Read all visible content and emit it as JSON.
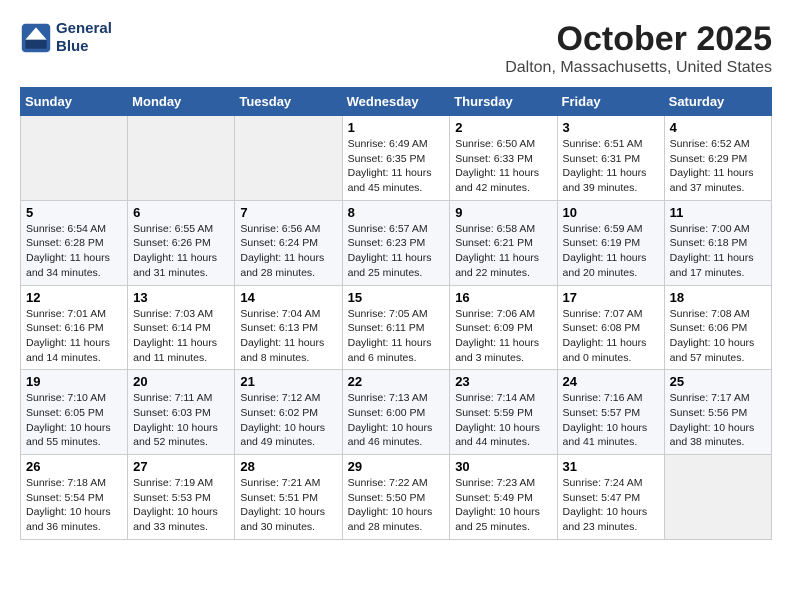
{
  "logo": {
    "line1": "General",
    "line2": "Blue"
  },
  "title": "October 2025",
  "location": "Dalton, Massachusetts, United States",
  "weekdays": [
    "Sunday",
    "Monday",
    "Tuesday",
    "Wednesday",
    "Thursday",
    "Friday",
    "Saturday"
  ],
  "weeks": [
    [
      {
        "day": "",
        "info": ""
      },
      {
        "day": "",
        "info": ""
      },
      {
        "day": "",
        "info": ""
      },
      {
        "day": "1",
        "info": "Sunrise: 6:49 AM\nSunset: 6:35 PM\nDaylight: 11 hours\nand 45 minutes."
      },
      {
        "day": "2",
        "info": "Sunrise: 6:50 AM\nSunset: 6:33 PM\nDaylight: 11 hours\nand 42 minutes."
      },
      {
        "day": "3",
        "info": "Sunrise: 6:51 AM\nSunset: 6:31 PM\nDaylight: 11 hours\nand 39 minutes."
      },
      {
        "day": "4",
        "info": "Sunrise: 6:52 AM\nSunset: 6:29 PM\nDaylight: 11 hours\nand 37 minutes."
      }
    ],
    [
      {
        "day": "5",
        "info": "Sunrise: 6:54 AM\nSunset: 6:28 PM\nDaylight: 11 hours\nand 34 minutes."
      },
      {
        "day": "6",
        "info": "Sunrise: 6:55 AM\nSunset: 6:26 PM\nDaylight: 11 hours\nand 31 minutes."
      },
      {
        "day": "7",
        "info": "Sunrise: 6:56 AM\nSunset: 6:24 PM\nDaylight: 11 hours\nand 28 minutes."
      },
      {
        "day": "8",
        "info": "Sunrise: 6:57 AM\nSunset: 6:23 PM\nDaylight: 11 hours\nand 25 minutes."
      },
      {
        "day": "9",
        "info": "Sunrise: 6:58 AM\nSunset: 6:21 PM\nDaylight: 11 hours\nand 22 minutes."
      },
      {
        "day": "10",
        "info": "Sunrise: 6:59 AM\nSunset: 6:19 PM\nDaylight: 11 hours\nand 20 minutes."
      },
      {
        "day": "11",
        "info": "Sunrise: 7:00 AM\nSunset: 6:18 PM\nDaylight: 11 hours\nand 17 minutes."
      }
    ],
    [
      {
        "day": "12",
        "info": "Sunrise: 7:01 AM\nSunset: 6:16 PM\nDaylight: 11 hours\nand 14 minutes."
      },
      {
        "day": "13",
        "info": "Sunrise: 7:03 AM\nSunset: 6:14 PM\nDaylight: 11 hours\nand 11 minutes."
      },
      {
        "day": "14",
        "info": "Sunrise: 7:04 AM\nSunset: 6:13 PM\nDaylight: 11 hours\nand 8 minutes."
      },
      {
        "day": "15",
        "info": "Sunrise: 7:05 AM\nSunset: 6:11 PM\nDaylight: 11 hours\nand 6 minutes."
      },
      {
        "day": "16",
        "info": "Sunrise: 7:06 AM\nSunset: 6:09 PM\nDaylight: 11 hours\nand 3 minutes."
      },
      {
        "day": "17",
        "info": "Sunrise: 7:07 AM\nSunset: 6:08 PM\nDaylight: 11 hours\nand 0 minutes."
      },
      {
        "day": "18",
        "info": "Sunrise: 7:08 AM\nSunset: 6:06 PM\nDaylight: 10 hours\nand 57 minutes."
      }
    ],
    [
      {
        "day": "19",
        "info": "Sunrise: 7:10 AM\nSunset: 6:05 PM\nDaylight: 10 hours\nand 55 minutes."
      },
      {
        "day": "20",
        "info": "Sunrise: 7:11 AM\nSunset: 6:03 PM\nDaylight: 10 hours\nand 52 minutes."
      },
      {
        "day": "21",
        "info": "Sunrise: 7:12 AM\nSunset: 6:02 PM\nDaylight: 10 hours\nand 49 minutes."
      },
      {
        "day": "22",
        "info": "Sunrise: 7:13 AM\nSunset: 6:00 PM\nDaylight: 10 hours\nand 46 minutes."
      },
      {
        "day": "23",
        "info": "Sunrise: 7:14 AM\nSunset: 5:59 PM\nDaylight: 10 hours\nand 44 minutes."
      },
      {
        "day": "24",
        "info": "Sunrise: 7:16 AM\nSunset: 5:57 PM\nDaylight: 10 hours\nand 41 minutes."
      },
      {
        "day": "25",
        "info": "Sunrise: 7:17 AM\nSunset: 5:56 PM\nDaylight: 10 hours\nand 38 minutes."
      }
    ],
    [
      {
        "day": "26",
        "info": "Sunrise: 7:18 AM\nSunset: 5:54 PM\nDaylight: 10 hours\nand 36 minutes."
      },
      {
        "day": "27",
        "info": "Sunrise: 7:19 AM\nSunset: 5:53 PM\nDaylight: 10 hours\nand 33 minutes."
      },
      {
        "day": "28",
        "info": "Sunrise: 7:21 AM\nSunset: 5:51 PM\nDaylight: 10 hours\nand 30 minutes."
      },
      {
        "day": "29",
        "info": "Sunrise: 7:22 AM\nSunset: 5:50 PM\nDaylight: 10 hours\nand 28 minutes."
      },
      {
        "day": "30",
        "info": "Sunrise: 7:23 AM\nSunset: 5:49 PM\nDaylight: 10 hours\nand 25 minutes."
      },
      {
        "day": "31",
        "info": "Sunrise: 7:24 AM\nSunset: 5:47 PM\nDaylight: 10 hours\nand 23 minutes."
      },
      {
        "day": "",
        "info": ""
      }
    ]
  ]
}
